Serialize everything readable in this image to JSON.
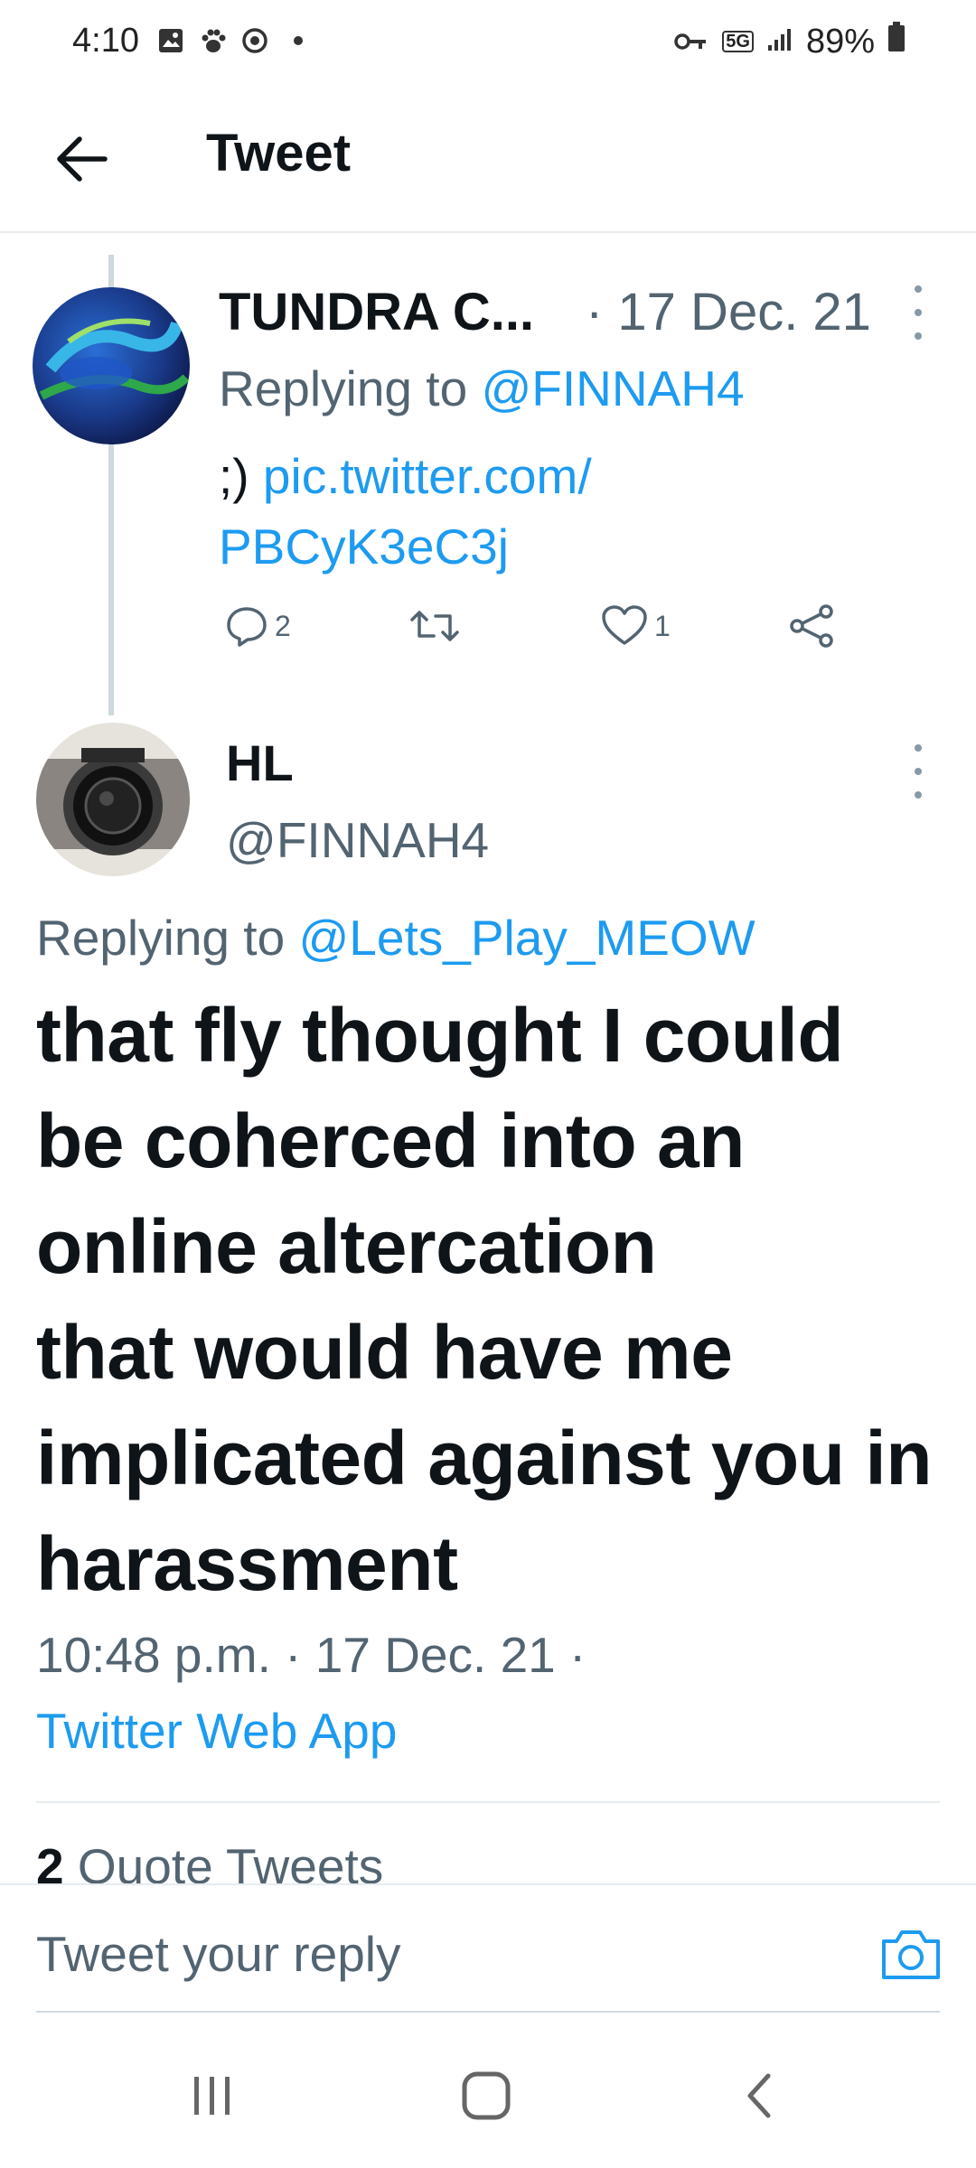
{
  "status_bar": {
    "time": "4:10",
    "battery": "89%",
    "network": "5G"
  },
  "header": {
    "title": "Tweet"
  },
  "tweet1": {
    "name": "TUNDRA C...",
    "date": "· 17 Dec. 21",
    "replying_prefix": "Replying to ",
    "replying_handle": "@FINNAH4",
    "body_prefix": ";) ",
    "body_link_line1": "pic.twitter.com/",
    "body_link_line2": "PBCyK3eC3j",
    "reply_count": "2",
    "like_count": "1"
  },
  "tweet2": {
    "name": "HL",
    "handle": "@FINNAH4",
    "replying_prefix": "Replying to ",
    "replying_handle": "@Lets_Play_MEOW",
    "body_lines": [
      "that fly thought I could",
      "be coherced into an",
      "online altercation",
      "that would have me",
      "implicated against you in",
      "harassment"
    ],
    "meta": "10:48 p.m. · 17 Dec. 21 ·",
    "source": "Twitter Web App",
    "quote_count": "2",
    "quote_label": "Quote Tweets"
  },
  "reply_bar": {
    "placeholder": "Tweet your reply"
  },
  "colors": {
    "accent": "#1d9bf0",
    "secondary_text": "#536471",
    "primary_text": "#0f1419"
  }
}
